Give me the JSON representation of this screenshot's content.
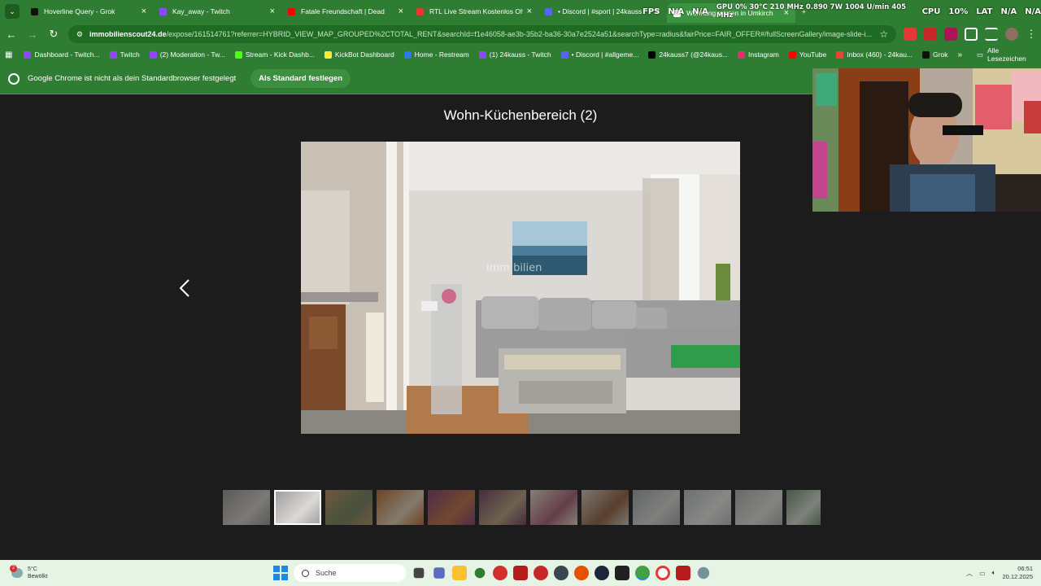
{
  "browser": {
    "tabs": [
      {
        "title": "Hoverline Query - Grok",
        "color": "#111111"
      },
      {
        "title": "Kay_away - Twitch",
        "color": "#9146ff"
      },
      {
        "title": "Fatale Freundschaft | Dead",
        "color": "#ff0000"
      },
      {
        "title": "RTL Live Stream Kostenlos Ohn",
        "color": "#e53935"
      },
      {
        "title": "• Discord | #sport | 24kauss",
        "color": "#5865f2"
      },
      {
        "title": "Wohnung mieten in Umkirch",
        "color": "#ffffff"
      }
    ],
    "active_tab_index": 5,
    "url_domain": "immobilienscout24.de",
    "url_path": "/expose/161514761?referrer=HYBRID_VIEW_MAP_GROUPED%2CTOTAL_RENT&searchId=f1e46058-ae3b-35b2-ba36-30a7e2524a51&searchType=radius&fairPrice=FAIR_OFFER#/fullScreenGallery/image-slide-i...",
    "bookmarks": [
      {
        "label": "Dashboard - Twitch...",
        "color": "#9146ff"
      },
      {
        "label": "Twitch",
        "color": "#9146ff"
      },
      {
        "label": "(2) Moderation - Tw...",
        "color": "#9146ff"
      },
      {
        "label": "Stream - Kick Dashb...",
        "color": "#53fc18"
      },
      {
        "label": "KickBot Dashboard",
        "color": "#ffeb3b"
      },
      {
        "label": "Home - Restream",
        "color": "#2979ff"
      },
      {
        "label": "(1) 24kauss - Twitch",
        "color": "#9146ff"
      },
      {
        "label": "• Discord | #allgeme...",
        "color": "#5865f2"
      },
      {
        "label": "24kauss7 (@24kaus...",
        "color": "#000000"
      },
      {
        "label": "Instagram",
        "color": "#e1306c"
      },
      {
        "label": "YouTube",
        "color": "#ff0000"
      },
      {
        "label": "Inbox (460) - 24kau...",
        "color": "#ea4335"
      },
      {
        "label": "Grok",
        "color": "#111111"
      }
    ],
    "bookmarks_more": "»",
    "all_bookmarks": "Alle Lesezeichen",
    "infobar_message": "Google Chrome ist nicht als dein Standardbrowser festgelegt",
    "infobar_button": "Als Standard festlegen"
  },
  "overlay": {
    "fps_label": "FPS",
    "fps_value": "N/A",
    "fps_value2": "N/A",
    "gpu_text": "GPU 0% 30°C 210 MHz 0.890 7W 1004 U/min 405 MHz",
    "cpu_label": "CPU",
    "cpu_value": "10%",
    "lat_label": "LAT",
    "lat_value": "N/A",
    "lat_value2": "N/A"
  },
  "gallery": {
    "title": "Wohn-Küchenbereich (2)",
    "watermark": "imm bilien",
    "thumbnail_count": 12,
    "selected_thumbnail": 1
  },
  "taskbar": {
    "temperature": "5°C",
    "weather": "Bewölkt",
    "notifications": "2",
    "search_placeholder": "Suche",
    "time": "06:51",
    "date": "20.12.2025"
  }
}
